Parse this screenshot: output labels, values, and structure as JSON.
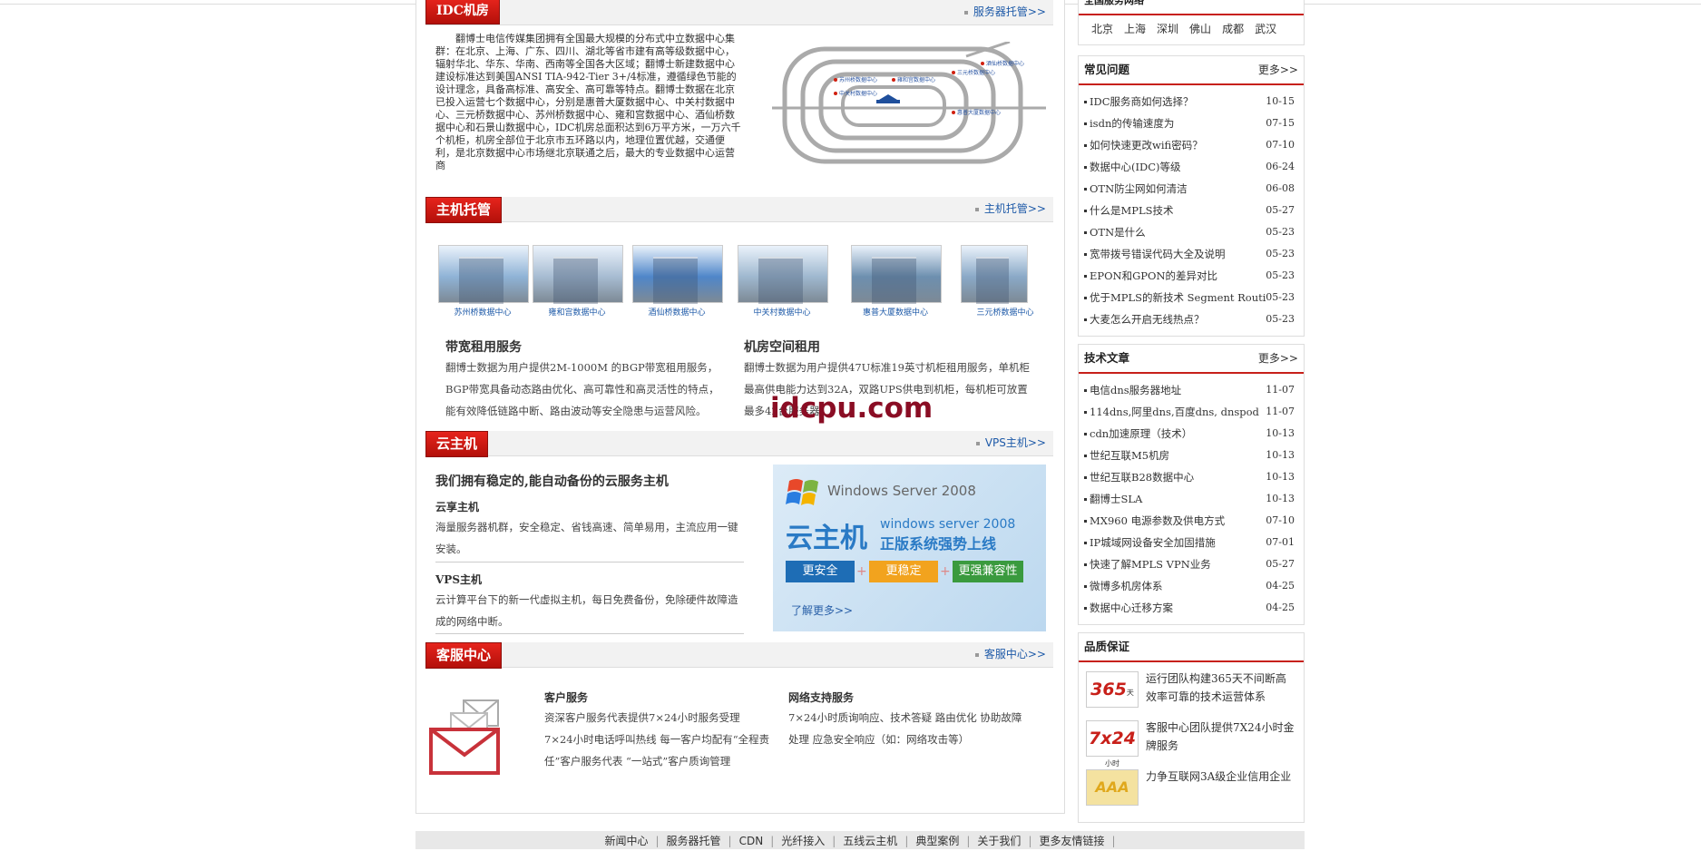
{
  "idc": {
    "tag": "IDC机房",
    "more": "服务器托管>>",
    "text": "　　翻博士电信传媒集团拥有全国最大规模的分布式中立数据中心集群：在北京、上海、广东、四川、湖北等省市建有高等级数据中心，辐射华北、华东、华南、西南等全国各大区域；翻博士新建数据中心建设标准达到美国ANSI TIA-942-Tier 3+/4标准，遵循绿色节能的设计理念，具备高标准、高安全、高可靠等特点。翻博士数据在北京已投入运营七个数据中心，分别是惠普大厦数据中心、中关村数据中心、三元桥数据中心、苏州桥数据中心、雍和宫数据中心、酒仙桥数据中心和石景山数据中心，IDC机房总面积达到6万平方米，一万六千个机柜，机房全部位于北京市五环路以内，地理位置优越，交通便利，是北京数据中心市场继北京联通之后，最大的专业数据中心运营商"
  },
  "hosting": {
    "tag": "主机托管",
    "more": "主机托管>>",
    "thumbs": [
      {
        "caption": "苏州桥数据中心",
        "color": "#8fb3d6"
      },
      {
        "caption": "雍和宫数据中心",
        "color": "#a7bcd2"
      },
      {
        "caption": "酒仙桥数据中心",
        "color": "#4f86c9"
      },
      {
        "caption": "中关村数据中心",
        "color": "#9fb8cf"
      },
      {
        "caption": "惠普大厦数据中心",
        "color": "#6d8faf"
      },
      {
        "caption": "三元桥数据中心",
        "color": "#8aa9c7"
      }
    ],
    "bandwidth": {
      "title": "带宽租用服务",
      "text": "翻博士数据为用户提供2M-1000M 的BGP带宽租用服务，BGP带宽具备动态路由优化、高可靠性和高灵活性的特点，能有效降低链路中断、路由波动等安全隐患与运营风险。"
    },
    "space": {
      "title": "机房空间租用",
      "text": "翻博士数据为用户提供47U标准19英寸机柜租用服务，单机柜最高供电能力达到32A，双路UPS供电到机柜，每机柜可放置最多42台服务器。"
    },
    "watermark": "idcpu.com"
  },
  "cloud": {
    "tag": "云主机",
    "more": "VPS主机>>",
    "headline": "我们拥有稳定的,能自动备份的云服务主机",
    "items": [
      {
        "title": "云享主机",
        "text": "海量服务器机群，安全稳定、省钱高速、简单易用，主流应用一键安装。"
      },
      {
        "title": "VPS主机",
        "text": "云计算平台下的新一代虚拟主机，每日免费备份，免除硬件故障造成的网络中断。"
      }
    ],
    "banner": {
      "product": "Windows Server",
      "year": "2008",
      "big": "云主机",
      "sub1": "windows server 2008",
      "sub2": "正版系统强势上线",
      "b1": "更安全",
      "b2": "更稳定",
      "b3": "更强兼容性",
      "link": "了解更多>>"
    }
  },
  "service": {
    "tag": "客服中心",
    "more": "客服中心>>",
    "customer": {
      "title": "客户服务",
      "text": "资深客户服务代表提供7×24小时服务受理 7×24小时电话呼叫热线 每一客户均配有“全程责任”客户服务代表 “一站式”客户质询管理"
    },
    "network": {
      "title": "网络支持服务",
      "text": "7×24小时质询响应、技术答疑 路由优化 协助故障处理 应急安全响应（如：网络攻击等）"
    }
  },
  "side": {
    "cities_title": "全国服务网络",
    "cities": [
      "北京",
      "上海",
      "深圳",
      "佛山",
      "成都",
      "武汉"
    ],
    "faq": {
      "title": "常见问题",
      "more": "更多>>",
      "items": [
        {
          "t": "IDC服务商如何选择？",
          "d": "10-15"
        },
        {
          "t": "isdn的传输速度为",
          "d": "07-15"
        },
        {
          "t": "如何快速更改wifi密码？",
          "d": "07-10"
        },
        {
          "t": "数据中心(IDC)等级",
          "d": "06-24"
        },
        {
          "t": "OTN防尘网如何清洁",
          "d": "06-08"
        },
        {
          "t": "什么是MPLS技术",
          "d": "05-27"
        },
        {
          "t": "OTN是什么",
          "d": "05-23"
        },
        {
          "t": "宽带拨号错误代码大全及说明",
          "d": "05-23"
        },
        {
          "t": "EPON和GPON的差异对比",
          "d": "05-23"
        },
        {
          "t": "优于MPLS的新技术 Segment Routi",
          "d": "05-23"
        },
        {
          "t": "大麦怎么开启无线热点？",
          "d": "05-23"
        }
      ]
    },
    "tech": {
      "title": "技术文章",
      "more": "更多>>",
      "items": [
        {
          "t": "电信dns服务器地址",
          "d": "11-07"
        },
        {
          "t": "114dns,阿里dns,百度dns, dnspod",
          "d": "11-07"
        },
        {
          "t": "cdn加速原理（技术）",
          "d": "10-13"
        },
        {
          "t": "世纪互联M5机房",
          "d": "10-13"
        },
        {
          "t": "世纪互联B28数据中心",
          "d": "10-13"
        },
        {
          "t": "翻博士SLA",
          "d": "10-13"
        },
        {
          "t": "MX960 电源参数及供电方式",
          "d": "07-10"
        },
        {
          "t": "IP城域网设备安全加固措施",
          "d": "07-01"
        },
        {
          "t": "快速了解MPLS VPN业务",
          "d": "05-27"
        },
        {
          "t": "微博多机房体系",
          "d": "04-25"
        },
        {
          "t": "数据中心迁移方案",
          "d": "04-25"
        }
      ]
    },
    "quality": {
      "title": "品质保证",
      "items": [
        {
          "badge": "365",
          "badge_sub": "天",
          "t": "运行团队构建365天不间断高效率可靠的技术运营体系"
        },
        {
          "badge": "7x24",
          "badge_sub": "小时",
          "t": "客服中心团队提供7X24小时金牌服务"
        },
        {
          "badge": "AAA",
          "badge_sub": "",
          "t": "力争互联网3A级企业信用企业"
        }
      ]
    }
  },
  "footer": [
    "新闻中心",
    "服务器托管",
    "CDN",
    "光纤接入",
    "五线云主机",
    "典型案例",
    "关于我们",
    "更多友情链接"
  ],
  "map_labels": [
    "苏州桥数据中心",
    "雍和宫数据中心",
    "三元桥数据中心",
    "酒仙桥数据中心",
    "中关村数据中心",
    "惠普大厦数据中心"
  ]
}
